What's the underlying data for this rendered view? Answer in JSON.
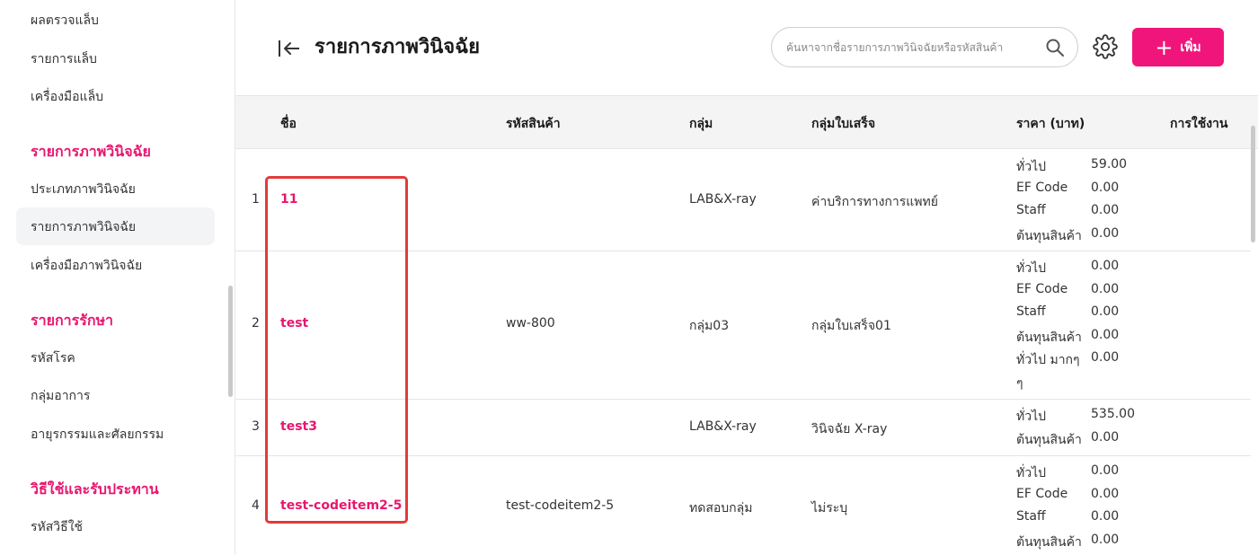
{
  "sidebar": {
    "items": [
      {
        "label": "ผลตรวจแล็บ"
      },
      {
        "label": "รายการแล็บ"
      },
      {
        "label": "เครื่องมือแล็บ"
      }
    ],
    "section_imaging": "รายการภาพวินิจฉัย",
    "imaging_items": [
      {
        "label": "ประเภทภาพวินิจฉัย"
      },
      {
        "label": "รายการภาพวินิจฉัย"
      },
      {
        "label": "เครื่องมือภาพวินิจฉัย"
      }
    ],
    "section_treatment": "รายการรักษา",
    "treatment_items": [
      {
        "label": "รหัสโรค"
      },
      {
        "label": "กลุ่มอาการ"
      },
      {
        "label": "อายุรกรรมและศัลยกรรม"
      }
    ],
    "section_usage": "วิธีใช้และรับประทาน",
    "usage_items": [
      {
        "label": "รหัสวิธีใช้"
      }
    ]
  },
  "header": {
    "title": "รายการภาพวินิจฉัย",
    "search_placeholder": "ค้นหาจากชื่อรายการภาพวินิจฉัยหรือรหัสสินค้า",
    "add_label": "เพิ่ม",
    "accent_color": "#f0157a"
  },
  "table": {
    "columns": [
      "ชื่อ",
      "รหัสสินค้า",
      "กลุ่ม",
      "กลุ่มใบเสร็จ",
      "ราคา (บาท)",
      "การใช้งาน"
    ],
    "rows": [
      {
        "no": "1",
        "name": "11",
        "code": "",
        "group": "LAB&X-ray",
        "receipt_group": "ค่าบริการทางการแพทย์",
        "prices": [
          {
            "label": "ทั่วไป",
            "value": "59.00"
          },
          {
            "label": "EF Code",
            "value": "0.00"
          },
          {
            "label": "Staff",
            "value": "0.00"
          },
          {
            "label": "ต้นทุนสินค้า",
            "value": "0.00"
          }
        ]
      },
      {
        "no": "2",
        "name": "test",
        "code": "ww-800",
        "group": "กลุ่ม03",
        "receipt_group": "กลุ่มใบเสร็จ01",
        "prices": [
          {
            "label": "ทั่วไป",
            "value": "0.00"
          },
          {
            "label": "EF Code",
            "value": "0.00"
          },
          {
            "label": "Staff",
            "value": "0.00"
          },
          {
            "label": "ต้นทุนสินค้า",
            "value": "0.00"
          },
          {
            "label": "ทั่วไป มากๆ",
            "value": "0.00"
          },
          {
            "label": "ๆ",
            "value": ""
          }
        ]
      },
      {
        "no": "3",
        "name": "test3",
        "code": "",
        "group": "LAB&X-ray",
        "receipt_group": "วินิจฉัย X-ray",
        "prices": [
          {
            "label": "ทั่วไป",
            "value": "535.00"
          },
          {
            "label": "ต้นทุนสินค้า",
            "value": "0.00"
          }
        ]
      },
      {
        "no": "4",
        "name": "test-codeitem2-5",
        "code": "test-codeitem2-5",
        "group": "ทดสอบกลุ่ม",
        "receipt_group": "ไม่ระบุ",
        "prices": [
          {
            "label": "ทั่วไป",
            "value": "0.00"
          },
          {
            "label": "EF Code",
            "value": "0.00"
          },
          {
            "label": "Staff",
            "value": "0.00"
          },
          {
            "label": "ต้นทุนสินค้า",
            "value": "0.00"
          }
        ]
      }
    ]
  }
}
